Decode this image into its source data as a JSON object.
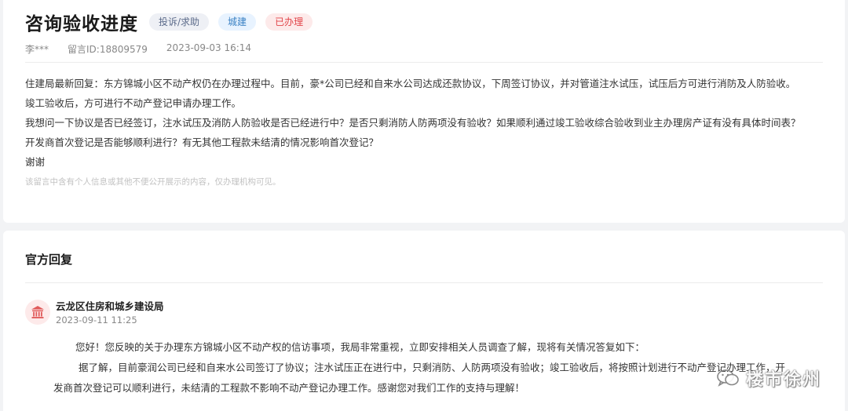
{
  "header": {
    "title": "咨询验收进度",
    "tags": [
      "投诉/求助",
      "城建",
      "已办理"
    ],
    "author": "李***",
    "message_id": "留言ID:18809579",
    "datetime": "2023-09-03 16:14"
  },
  "message": {
    "lines": [
      "住建局最新回复：东方锦城小区不动产权仍在办理过程中。目前，豪*公司已经和自来水公司达成还款协议，下周签订协议，并对管道注水试压，试压后方可进行消防及人防验收。",
      "竣工验收后，方可进行不动产登记申请办理工作。",
      "我想问一下协议是否已经签订，注水试压及消防人防验收是否已经进行中？是否只剩消防人防两项没有验收？如果顺利通过竣工验收综合验收到业主办理房产证有没有具体时间表？",
      "开发商首次登记是否能够顺利进行？有无其他工程款未结清的情况影响首次登记？",
      "谢谢"
    ],
    "privacy_note": "该留言中含有个人信息或其他不便公开展示的内容，仅办理机构可见。"
  },
  "official": {
    "section_title": "官方回复",
    "org_name": "云龙区住房和城乡建设局",
    "reply_date": "2023-09-11 11:25",
    "reply_lines": [
      "您好！您反映的关于办理东方锦城小区不动产权的信访事项，我局非常重视，立即安排相关人员调查了解，现将有关情况答复如下：",
      "据了解，目前豪润公司已经和自来水公司签订了协议；注水试压正在进行中，只剩消防、人防两项没有验收；竣工验收后，将按照计划进行不动产登记办理工作，开",
      "发商首次登记可以顺利进行，未结清的工程款不影响不动产登记办理工作。感谢您对我们工作的支持与理解！"
    ]
  },
  "watermark": {
    "text": "楼市徐州",
    "icon": "wechat-icon"
  },
  "colors": {
    "tag_gray_text": "#5c6b8a",
    "tag_blue_text": "#3b82c4",
    "tag_red_text": "#e2454a",
    "org_icon": "#e05a5a"
  }
}
